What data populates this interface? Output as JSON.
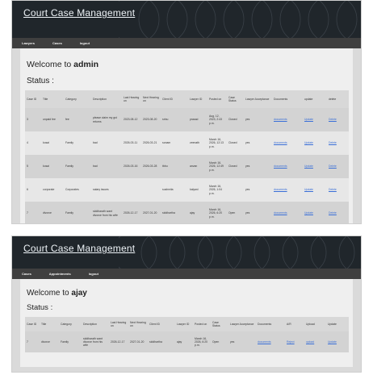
{
  "app": {
    "title": "Court Case Management"
  },
  "admin_view": {
    "nav": [
      "Lawyers",
      "Cases",
      "logout"
    ],
    "welcome_prefix": "Welcome to",
    "user": "admin",
    "status_label": "Status :",
    "columns": [
      "Case ID",
      "Title",
      "Category",
      "Description",
      "Last Hearing on",
      "Next Hearing on",
      "Client ID",
      "Lawyer ID",
      "Posted on",
      "Case Status",
      "Lawyer Acceptance",
      "Documents",
      "update",
      "delete"
    ],
    "rows": [
      [
        "3",
        "unpaid fee",
        "fee",
        "please claim my gst returns",
        "2023-08-12",
        "2023-08-20",
        "srinu",
        "prasad",
        "Aug. 12, 2023, 2:43 p.m.",
        "Closed",
        "yes",
        "documents",
        "Update",
        "Delete"
      ],
      [
        "4",
        "kosai",
        "Family",
        "bad",
        "2026-03-11",
        "2026-03-21",
        "sonam",
        "zeenath",
        "March 16, 2026, 12:13 p.m.",
        "Closed",
        "yes",
        "documents",
        "Update",
        "Delete"
      ],
      [
        "5",
        "kosai",
        "Family",
        "bad",
        "2026-03-16",
        "2026-03-28",
        "tbbu",
        "anvan",
        "March 16, 2026, 12:49 p.m.",
        "Closed",
        "yes",
        "documents",
        "Update",
        "Delete"
      ],
      [
        "6",
        "corporate",
        "Corporates",
        "salary issues",
        "",
        "",
        "sushmita",
        "kalyani",
        "March 16, 2026, 1:04 p.m.",
        "",
        "yes",
        "documents",
        "Update",
        "Delete"
      ],
      [
        "7",
        "divorce",
        "Family",
        "siddharath want divorce from his wife",
        "2026-12-17",
        "2027-01-20",
        "siddhartha",
        "ajay",
        "March 16, 2026, 6:20 p.m.",
        "Open",
        "yes",
        "documents",
        "Update",
        "Delete"
      ]
    ]
  },
  "lawyer_view": {
    "nav": [
      "Cases",
      "Appointments",
      "logout"
    ],
    "welcome_prefix": "Welcome to",
    "user": "ajay",
    "status_label": "Status :",
    "columns": [
      "Case ID",
      "Title",
      "Category",
      "Description",
      "Last Hearing on",
      "Next Hearing on",
      "Client ID",
      "Lawyer ID",
      "Posted on",
      "Case Status",
      "Lawyer Acceptance",
      "Documents",
      "A/R",
      "Upload",
      "Update"
    ],
    "rows": [
      [
        "7",
        "divorce",
        "Family",
        "siddharath want divorce from his wife",
        "2026-12-17",
        "2027-01-20",
        "siddhartha",
        "ajay",
        "March 16, 2026, 6:20 p.m.",
        "Open",
        "yes",
        "documents",
        "Reject",
        "upload",
        "Update"
      ]
    ]
  },
  "colors": {
    "banner": "#20262b",
    "navbar": "#3f3f3f",
    "link": "#3a6fd8"
  }
}
